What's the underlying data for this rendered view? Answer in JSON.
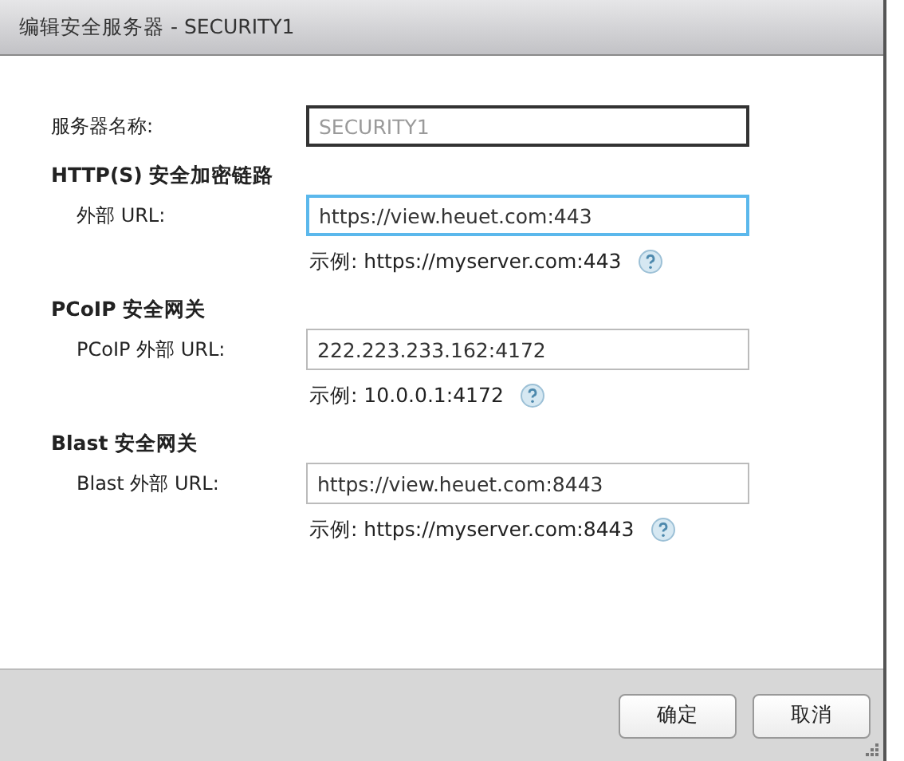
{
  "window": {
    "title": "编辑安全服务器 - SECURITY1"
  },
  "server_name": {
    "label": "服务器名称:",
    "value": "SECURITY1",
    "disabled": true
  },
  "sections": [
    {
      "heading": "HTTP(S) 安全加密链路",
      "label": "外部 URL:",
      "value": "https://view.heuet.com:443",
      "focused": true,
      "example": "示例: https://myserver.com:443"
    },
    {
      "heading": "PCoIP 安全网关",
      "label": "PCoIP 外部 URL:",
      "value": "222.223.233.162:4172",
      "focused": false,
      "example": "示例: 10.0.0.1:4172"
    },
    {
      "heading": "Blast 安全网关",
      "label": "Blast 外部 URL:",
      "value": "https://view.heuet.com:8443",
      "focused": false,
      "example": "示例: https://myserver.com:8443"
    }
  ],
  "buttons": [
    "确定",
    "取消"
  ]
}
